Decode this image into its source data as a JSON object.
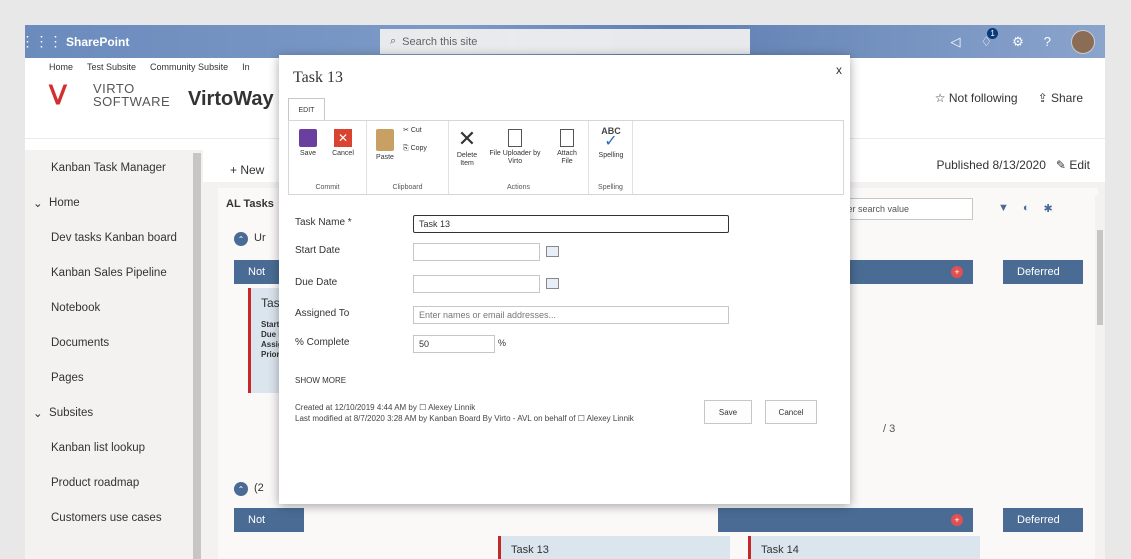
{
  "suite": {
    "brand": "SharePoint",
    "search_placeholder": "Search this site"
  },
  "breadcrumb": [
    "Home",
    "Test Subsite",
    "Community Subsite",
    "In"
  ],
  "site": {
    "logo_top": "VIRTO",
    "logo_bottom": "SOFTWARE",
    "title": "VirtoWay T",
    "follow": "☆ Not following",
    "share": "⇪ Share"
  },
  "cmd": {
    "new": "+ New",
    "published": "Published 8/13/2020",
    "edit": "Edit"
  },
  "nav": [
    {
      "label": "Kanban Task Manager",
      "group": false
    },
    {
      "label": "Home",
      "group": true
    },
    {
      "label": "Dev tasks Kanban board",
      "group": false
    },
    {
      "label": "Kanban Sales Pipeline",
      "group": false
    },
    {
      "label": "Notebook",
      "group": false
    },
    {
      "label": "Documents",
      "group": false
    },
    {
      "label": "Pages",
      "group": false
    },
    {
      "label": "Subsites",
      "group": true
    },
    {
      "label": "Kanban list lookup",
      "group": false
    },
    {
      "label": "Product roadmap",
      "group": false
    },
    {
      "label": "Customers use cases",
      "group": false
    }
  ],
  "board": {
    "title": "AL Tasks",
    "search_value": "ter search value",
    "group1": "Ur",
    "group2": "(2",
    "col_not": "Not",
    "col_deferred": "Deferred",
    "card_peek": "Task",
    "card_fields": "Start\nDue I\nAssig\nPrior",
    "card13": "Task 13",
    "card14": "Task 14",
    "page": "/ 3"
  },
  "dialog": {
    "title": "Task 13",
    "close": "x",
    "tab": "EDIT",
    "ribbon": {
      "save": "Save",
      "cancel": "Cancel",
      "commit": "Commit",
      "paste": "Paste",
      "cut": "Cut",
      "copy": "Copy",
      "clipboard": "Clipboard",
      "delete": "Delete Item",
      "uploader": "File Uploader by Virto",
      "attach": "Attach File",
      "actions": "Actions",
      "spelling_btn": "Spelling",
      "spelling": "Spelling",
      "abc": "ABC"
    },
    "fields": {
      "task_name_label": "Task Name *",
      "task_name_value": "Task 13",
      "start_label": "Start Date",
      "due_label": "Due Date",
      "assigned_label": "Assigned To",
      "assigned_placeholder": "Enter names or email addresses...",
      "complete_label": "% Complete",
      "complete_value": "50",
      "percent": "%",
      "show_more": "SHOW MORE"
    },
    "meta": {
      "created": "Created at 12/10/2019 4:44 AM  by",
      "created_by": "Alexey Linnik",
      "modified": "Last modified at 8/7/2020 3:28 AM  by Kanban Board By Virto - AVL on behalf of",
      "modified_by": "Alexey Linnik"
    },
    "save": "Save",
    "cancel": "Cancel"
  },
  "colors": {
    "suitebar": "#6b8bbd",
    "column_header": "#4a6c94",
    "card_border": "#c62828",
    "save_icon": "#6b3fa0",
    "cancel_icon": "#d9432f"
  }
}
